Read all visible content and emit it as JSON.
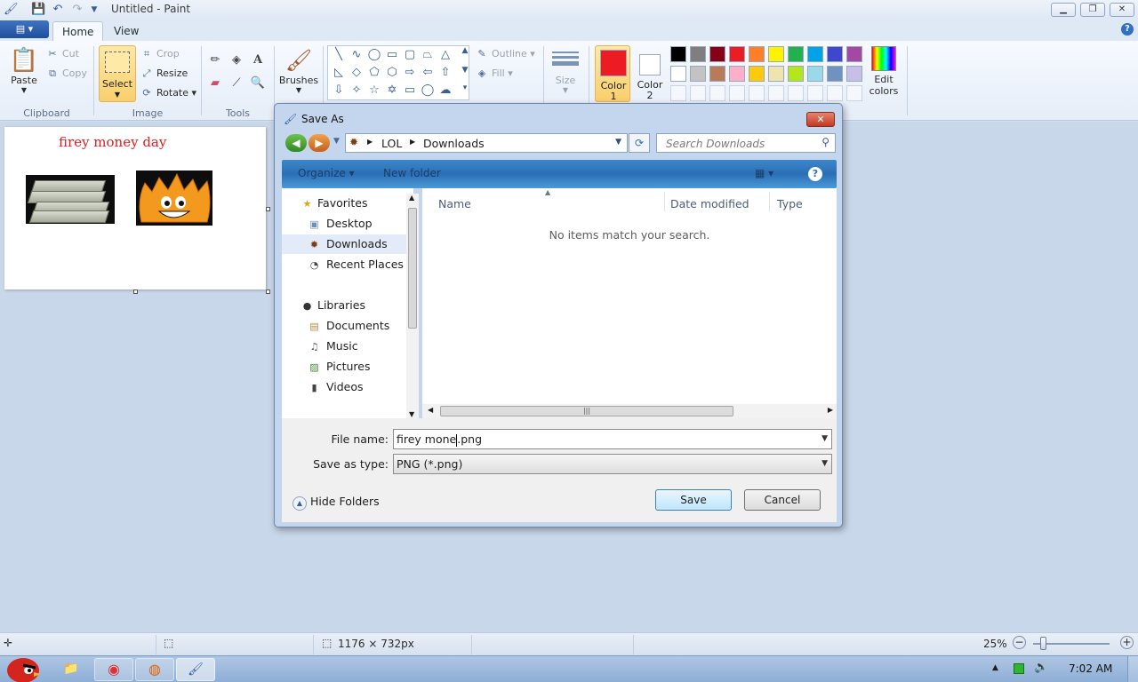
{
  "window": {
    "title": "Untitled - Paint"
  },
  "ribbon": {
    "tabs": [
      "Home",
      "View"
    ],
    "clipboard": {
      "paste": "Paste",
      "cut": "Cut",
      "copy": "Copy",
      "group": "Clipboard"
    },
    "image": {
      "select": "Select",
      "crop": "Crop",
      "resize": "Resize",
      "rotate": "Rotate",
      "group": "Image"
    },
    "tools": {
      "group": "Tools"
    },
    "brushes": "Brushes",
    "shapes": {
      "outline": "Outline",
      "fill": "Fill"
    },
    "size": "Size",
    "color1": {
      "line1": "Color",
      "line2": "1",
      "color": "#ed1c24"
    },
    "color2": {
      "line1": "Color",
      "line2": "2",
      "color": "#ffffff"
    },
    "edit_colors": {
      "line1": "Edit",
      "line2": "colors"
    },
    "palette_row1": [
      "#000000",
      "#7f7f7f",
      "#880015",
      "#ed1c24",
      "#ff7f27",
      "#fff200",
      "#22b14c",
      "#00a2e8",
      "#3f48cc",
      "#a349a4"
    ],
    "palette_row2": [
      "#ffffff",
      "#c3c3c3",
      "#b97a57",
      "#ffaec9",
      "#ffc90e",
      "#efe4b0",
      "#b5e61d",
      "#99d9ea",
      "#7092be",
      "#c8bfe7"
    ]
  },
  "canvas": {
    "text": "firey money day"
  },
  "dialog": {
    "title": "Save As",
    "breadcrumb": [
      "LOL",
      "Downloads"
    ],
    "search_placeholder": "Search Downloads",
    "toolbar": {
      "organize": "Organize",
      "new_folder": "New folder"
    },
    "nav": {
      "favorites": "Favorites",
      "desktop": "Desktop",
      "downloads": "Downloads",
      "recent": "Recent Places",
      "libraries": "Libraries",
      "documents": "Documents",
      "music": "Music",
      "pictures": "Pictures",
      "videos": "Videos"
    },
    "columns": [
      "Name",
      "Date modified",
      "Type"
    ],
    "empty_message": "No items match your search.",
    "file_name_label": "File name:",
    "file_name_value": "firey mone.png",
    "save_type_label": "Save as type:",
    "save_type_value": "PNG (*.png)",
    "hide_folders": "Hide Folders",
    "save": "Save",
    "cancel": "Cancel"
  },
  "status": {
    "dimensions": "1176 × 732px",
    "zoom": "25%"
  },
  "taskbar": {
    "clock": "7:02 AM"
  }
}
